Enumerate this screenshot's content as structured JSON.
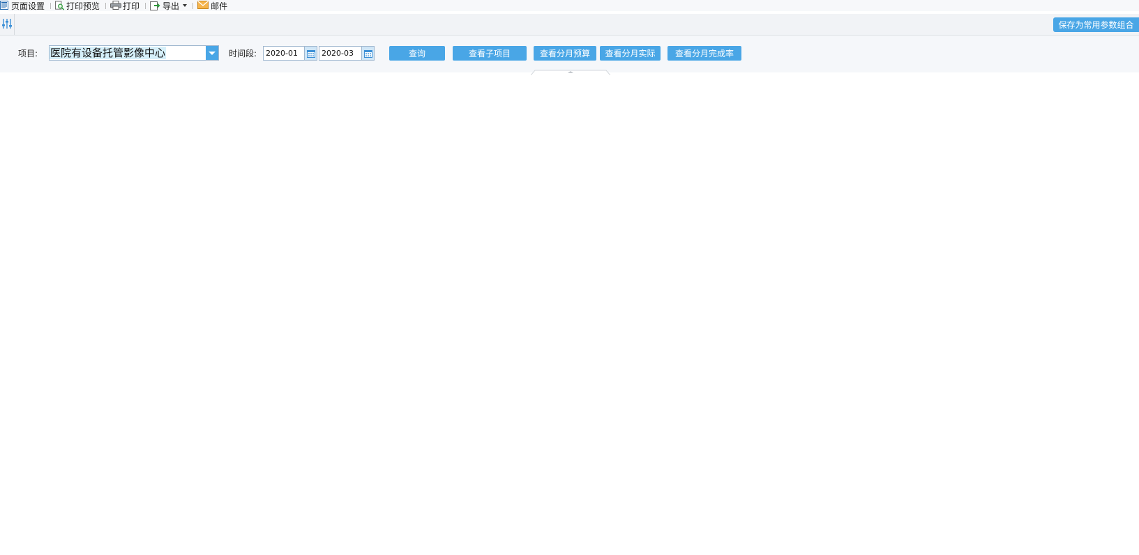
{
  "toolbar": {
    "page_setup": "页面设置",
    "print_preview": "打印预览",
    "print": "打印",
    "export": "导出",
    "mail": "邮件"
  },
  "bar2": {
    "save_combo": "保存为常用参数组合"
  },
  "query": {
    "project_label": "项目:",
    "project_value": "医院有设备托管影像中心",
    "period_label": "时间段:",
    "date_from": "2020-01",
    "date_to": "2020-03",
    "buttons": {
      "search": "查询",
      "view_sub": "查看子项目",
      "monthly_budget": "查看分月预算",
      "monthly_actual": "查看分月实际",
      "monthly_rate": "查看分月完成率"
    }
  },
  "colors": {
    "accent": "#49a6e6",
    "toolbar_bg": "#f7f8fa",
    "panel_bg": "#f5f7fa",
    "selection": "#d6f0fa"
  }
}
